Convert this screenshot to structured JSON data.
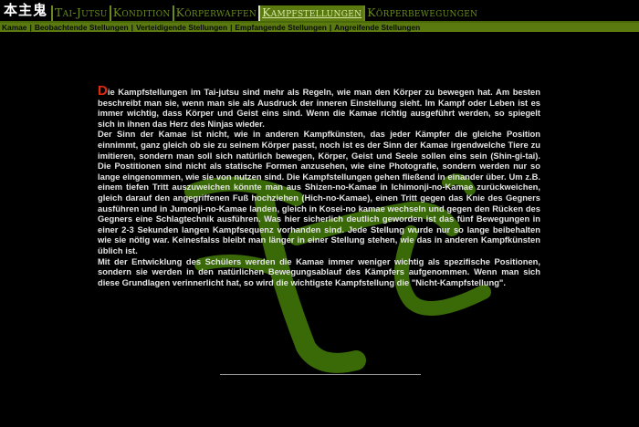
{
  "header": {
    "logo": "本主鬼",
    "nav": [
      {
        "label": "Tai-Jutsu",
        "active": false
      },
      {
        "label": "Kondition",
        "active": false
      },
      {
        "label": "Körperwaffen",
        "active": false
      },
      {
        "label": "Kampfstellungen",
        "active": true
      },
      {
        "label": "Körperbewegungen",
        "active": false
      }
    ]
  },
  "subnav": [
    "Kamae",
    "Beobachtende Stellungen",
    "Verteidigende Stellungen",
    "Empfangende Stellungen",
    "Angreifende Stellungen"
  ],
  "content": {
    "dropcap": "D",
    "paragraphs": [
      "ie Kampfstellungen im Tai-jutsu sind mehr als Regeln, wie man den Körper zu bewegen hat. Am besten beschreibt man sie, wenn man sie als Ausdruck der inneren Einstellung sieht. Im Kampf oder Leben ist es immer wichtig, dass Körper und Geist eins sind. Wenn die Kamae richtig ausgeführt werden, so spiegelt sich in ihnen das Herz des Ninjas wieder.",
      "Der Sinn der Kamae ist nicht, wie in anderen Kampfkünsten, das jeder Kämpfer die gleiche Position einnimmt, ganz gleich ob sie zu seinem Körper passt, noch ist es der Sinn der Kamae irgendwelche Tiere zu imitieren, sondern man soll sich natürlich bewegen, Körper, Geist und Seele sollen eins sein (Shin-gi-tai). Die Postitionen sind nicht als statische Formen anzusehen, wie eine Photografie, sondern werden nur so lange eingenommen, wie sie von nutzen sind. Die Kampfstellungen gehen fließend in einander über. Um z.B. einem tiefen Tritt auszuweichen könnte man aus Shizen-no-Kamae in Ichimonji-no-Kamae zurückweichen, gleich darauf den angegriffenen Fuß hochziehen (Hich-no-Kamae), einen Tritt gegen das Knie des Gegners ausführen und in Jumonji-no-Kamae landen, gleich in Kosei-no kamae wechseln und gegen den Rücken des Gegners eine Schlagtechnik ausführen. Was hier sicherlich deutlich geworden ist das fünf Bewegungen in einer 2-3 Sekunden langen Kampfsequenz vorhanden sind. Jede Stellung wurde nur so lange beibehalten wie sie nötig war. Keinesfalss bleibt man länger in einer Stellung stehen, wie das in anderen Kampfkünsten üblich ist.",
      "Mit der Entwicklung des Schülers werden die Kamae immer weniger wichtig als spezifische Positionen, sondern sie werden in den natürlichen Bewegungsablauf des Kämpfers aufgenommen. Wenn man sich diese Grundlagen verinnerlicht hat, so wird die wichtigste Kampfstellung die \"Nicht-Kampfstellung\"."
    ]
  },
  "colors": {
    "accent_green": "#5a7a10",
    "dropcap_red": "#e02a10",
    "background": "#000000"
  }
}
